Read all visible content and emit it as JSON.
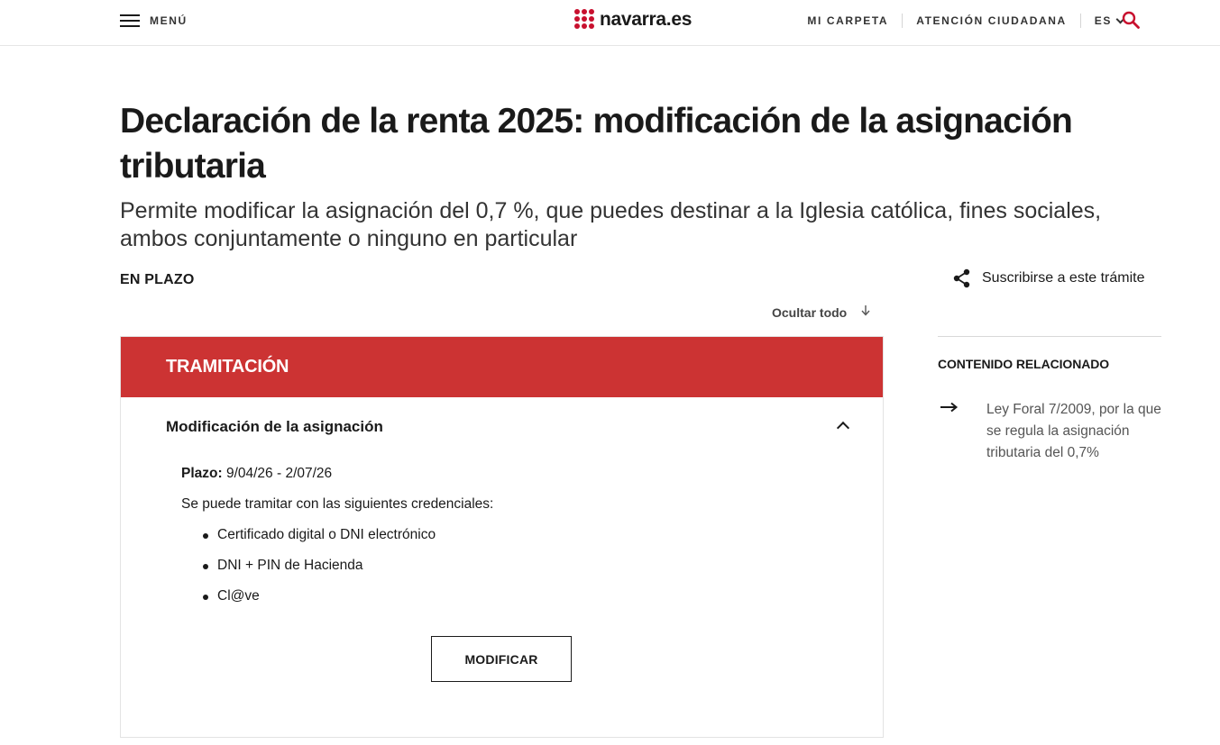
{
  "header": {
    "menu_label": "MENÚ",
    "logo_text": "navarra.es",
    "nav": [
      "MI CARPETA",
      "ATENCIÓN CIUDADANA"
    ],
    "lang": "ES",
    "brand_color": "#c8102e"
  },
  "main": {
    "title": "Declaración de la renta 2025: modificación de la asignación tributaria",
    "subtitle": "Permite modificar la asignación del 0,7 %, que puedes destinar a la Iglesia católica, fines sociales, ambos conjuntamente o ninguno en particular",
    "status": "EN PLAZO",
    "hide_all": "Ocultar todo"
  },
  "tramitacion": {
    "header": "TRAMITACIÓN",
    "header_color": "#cc3333",
    "accordion_title": "Modificación de la asignación",
    "plazo_label": "Plazo:",
    "plazo_value": " 9/04/26 - 2/07/26",
    "credentials_intro": "Se puede tramitar con las siguientes credenciales:",
    "credentials": [
      "Certificado digital o DNI electrónico",
      "DNI + PIN de Hacienda",
      "Cl@ve"
    ],
    "button_label": "MODIFICAR"
  },
  "sidebar": {
    "subscribe_label": "Suscribirse a este trámite",
    "related_title": "CONTENIDO RELACIONADO",
    "related_link": "Ley Foral 7/2009, por la que se regula la asignación tributaria del 0,7%"
  }
}
